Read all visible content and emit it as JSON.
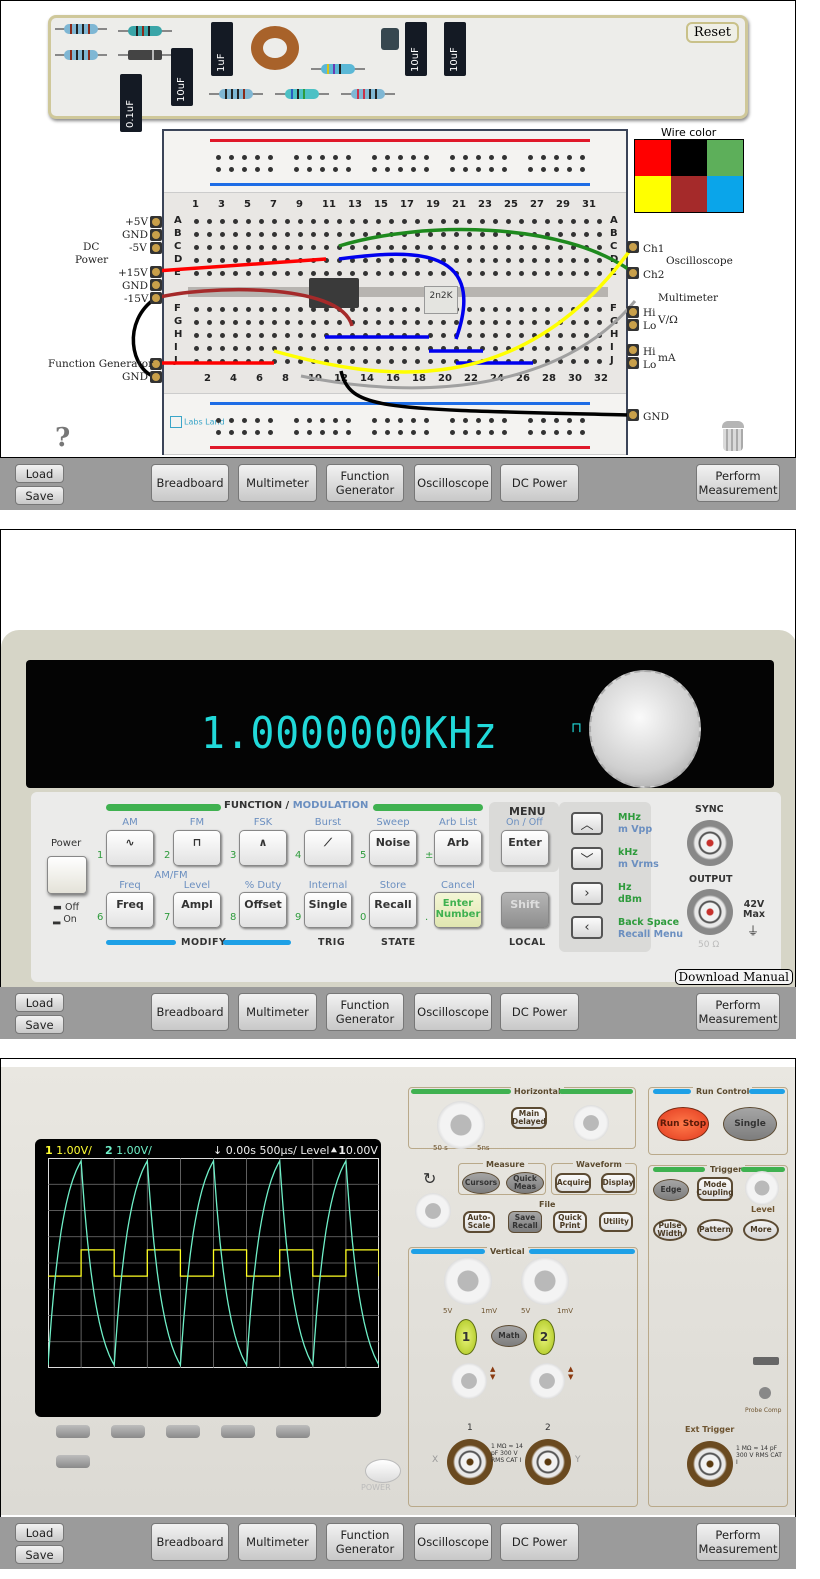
{
  "toolbar": {
    "load": "Load",
    "save": "Save",
    "breadboard": "Breadboard",
    "multimeter": "Multimeter",
    "function_generator_line1": "Function",
    "function_generator_line2": "Generator",
    "oscilloscope": "Oscilloscope",
    "dc_power": "DC Power",
    "perform_line1": "Perform",
    "perform_line2": "Measurement"
  },
  "breadboard_panel": {
    "reset": "Reset",
    "components": {
      "capacitors": [
        "0.1uF",
        "10uF",
        "1uF",
        "10uF",
        "10uF"
      ],
      "chip_label": "2n2K"
    },
    "column_numbers_top": [
      "1",
      "3",
      "5",
      "7",
      "9",
      "11",
      "13",
      "15",
      "17",
      "19",
      "21",
      "23",
      "25",
      "27",
      "29",
      "31"
    ],
    "column_numbers_bottom": [
      "2",
      "4",
      "6",
      "8",
      "10",
      "12",
      "14",
      "16",
      "18",
      "20",
      "22",
      "24",
      "26",
      "28",
      "30",
      "32"
    ],
    "rows_top": [
      "A",
      "B",
      "C",
      "D",
      "E"
    ],
    "rows_bottom": [
      "F",
      "G",
      "H",
      "I",
      "J"
    ],
    "left_labels": {
      "p5v": "+5V",
      "gnd1": "GND",
      "m5v": "-5V",
      "dc_power_1": "DC",
      "dc_power_2": "Power",
      "p15v": "+15V",
      "gnd2": "GND",
      "m15v": "-15V",
      "function_generator": "Function Generator",
      "gnd3": "GND"
    },
    "right_labels": {
      "ch1": "Ch1",
      "ch2": "Ch2",
      "oscilloscope": "Oscilloscope",
      "multimeter": "Multimeter",
      "hi1": "Hi",
      "lo1": "Lo",
      "vohm": "V/Ω",
      "hi2": "Hi",
      "lo2": "Lo",
      "ma": "mA",
      "gnd": "GND"
    },
    "wire_color": {
      "title": "Wire color",
      "colors": [
        "#ff0000",
        "#000000",
        "#5daf5a",
        "#ffff00",
        "#a52a2a",
        "#0aa5ea"
      ]
    },
    "logo": "Labs Land",
    "help_icon": "?"
  },
  "function_generator_panel": {
    "readout": "1.0000000KHz",
    "wave_indicator": "square",
    "power_label": "Power",
    "off_label": "Off",
    "on_label": "On",
    "function_modulation": "FUNCTION /",
    "modulation": "MODULATION",
    "top_labels": [
      "AM",
      "FM",
      "FSK",
      "Burst",
      "Sweep",
      "Arb List"
    ],
    "row1_keys": [
      "∿",
      "⊓",
      "∧",
      "⟋",
      "Noise",
      "Arb"
    ],
    "row1_nums": [
      "1",
      "2",
      "3",
      "4",
      "5",
      "±"
    ],
    "amfm": "AM/FM",
    "mid_labels": [
      "Freq",
      "Level",
      "% Duty",
      "Internal",
      "Store",
      "Cancel"
    ],
    "row2_keys": [
      "Freq",
      "Ampl",
      "Offset",
      "Single",
      "Recall",
      "Enter Number"
    ],
    "row2_nums": [
      "6",
      "7",
      "8",
      "9",
      "0",
      "."
    ],
    "bottom_labels": {
      "modify": "MODIFY",
      "trig": "TRIG",
      "state": "STATE",
      "local": "LOCAL"
    },
    "menu": "MENU",
    "menu_sub": "On / Off",
    "enter": "Enter",
    "shift": "Shift",
    "units": [
      {
        "a": "MHz",
        "b": "m Vpp"
      },
      {
        "a": "kHz",
        "b": "m Vrms"
      },
      {
        "a": "Hz",
        "b": "dBm"
      },
      {
        "a": "Back Space",
        "b": "Recall Menu"
      }
    ],
    "sync": "SYNC",
    "output": "OUTPUT",
    "max_1": "42V",
    "max_2": "Max",
    "ohm": "50 Ω",
    "download_manual": "Download Manual"
  },
  "oscilloscope_panel": {
    "ch1_scale": "1.00V/",
    "ch2_scale": "1.00V/",
    "ch1_num": "1",
    "ch2_num": "2",
    "time_offset": "0.00s",
    "timebase": "500µs/",
    "trigger": "Level",
    "trigger_ch": "1",
    "trigger_level": "0.00V",
    "horizontal": "Horizontal",
    "h_left": "50 s",
    "h_right": "5ns",
    "main_delayed": "Main Delayed",
    "run_control": "Run Control",
    "run_stop": "Run Stop",
    "single": "Single",
    "measure": "Measure",
    "cursors": "Cursors",
    "quick_meas": "Quick Meas",
    "waveform": "Waveform",
    "acquire": "Acquire",
    "display": "Display",
    "file": "File",
    "auto_scale": "Auto- Scale",
    "save_recall": "Save Recall",
    "quick_print": "Quick Print",
    "utility": "Utility",
    "trigger_section": "Trigger",
    "edge": "Edge",
    "mode_coupling": "Mode Coupling",
    "level": "Level",
    "pulse_width": "Pulse Width",
    "pattern": "Pattern",
    "more": "More",
    "vertical": "Vertical",
    "v_left": "5V",
    "v_right": "1mV",
    "ch1_btn": "1",
    "math": "Math",
    "ch2_btn": "2",
    "input1": "1",
    "input2": "2",
    "x": "X",
    "y": "Y",
    "input_spec": "1 MΩ ≈ 14 pF 300 V RMS CAT I",
    "probe_comp": "Probe Comp",
    "ext_trigger": "Ext Trigger",
    "power": "POWER"
  }
}
